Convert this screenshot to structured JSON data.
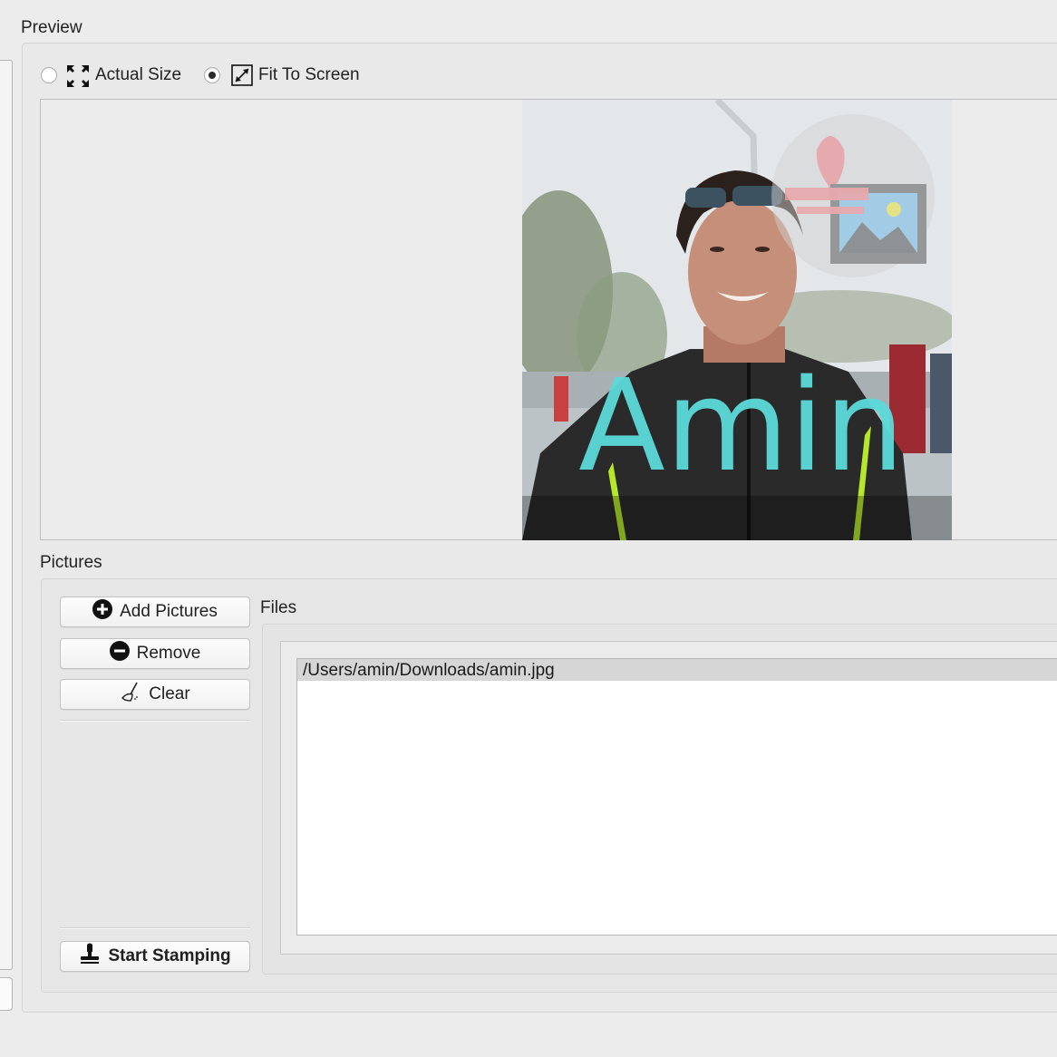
{
  "preview": {
    "title": "Preview",
    "view_modes": [
      {
        "label": "Actual Size",
        "icon": "expand-arrows-icon",
        "selected": false
      },
      {
        "label": "Fit To Screen",
        "icon": "resize-diagonal-icon",
        "selected": true
      }
    ],
    "image": {
      "watermark_text": "Amin",
      "watermark_color": "#5cdada",
      "stamp_logo": "stamp-picture-logo"
    }
  },
  "pictures": {
    "title": "Pictures",
    "buttons": {
      "add": "Add Pictures",
      "remove": "Remove",
      "clear": "Clear",
      "start": "Start Stamping"
    },
    "files": {
      "title": "Files",
      "items": [
        "/Users/amin/Downloads/amin.jpg"
      ],
      "selected_index": 0
    }
  }
}
